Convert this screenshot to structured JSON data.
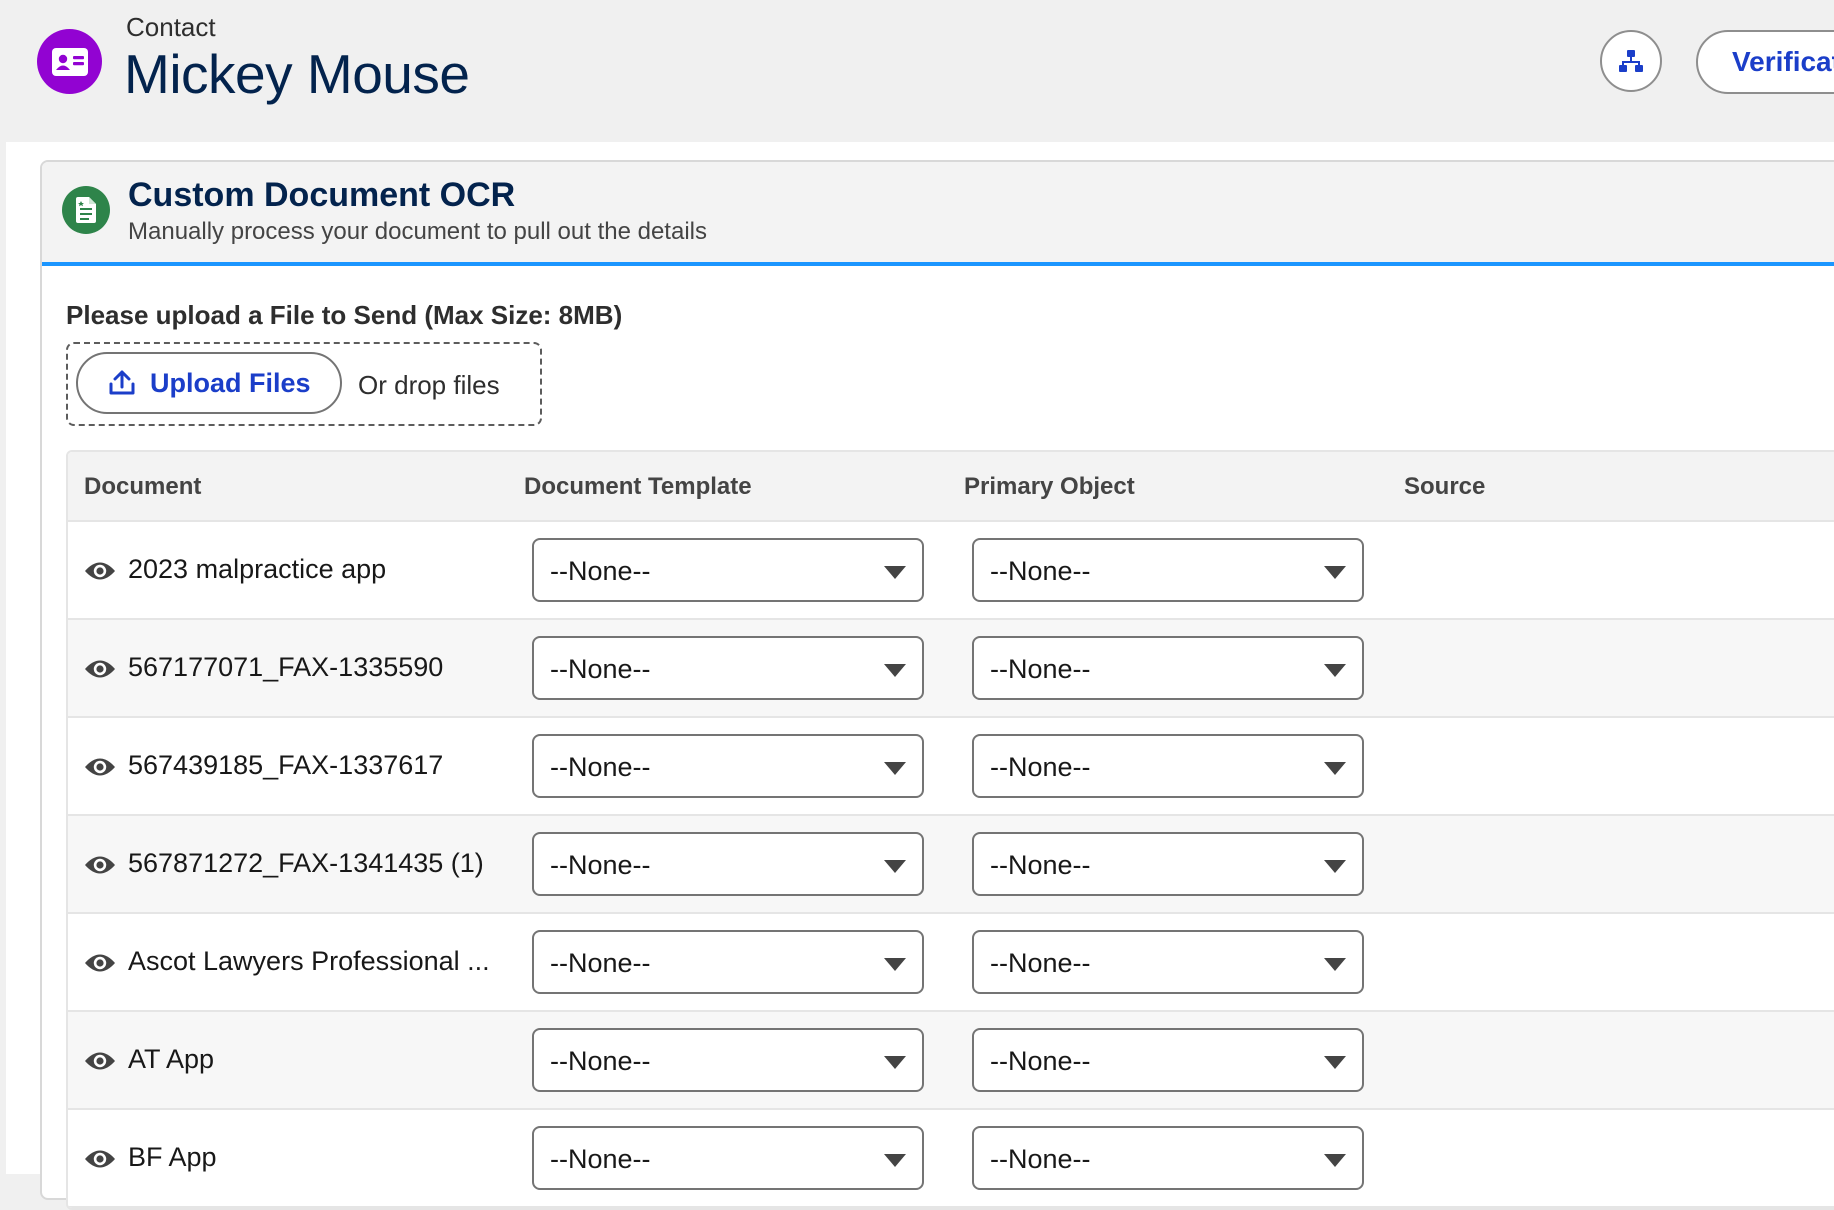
{
  "header": {
    "record_type": "Contact",
    "record_name": "Mickey Mouse",
    "verification_label": "Verificat",
    "icons": {
      "record": "contact-card-icon",
      "hierarchy": "hierarchy-icon"
    }
  },
  "card": {
    "title": "Custom Document OCR",
    "subtitle": "Manually process your document to pull out the details",
    "icon": "document-icon",
    "upload_label": "Please upload a File to Send (Max Size: 8MB)",
    "upload_button": "Upload Files",
    "drop_text": "Or drop files"
  },
  "table": {
    "columns": [
      "Document",
      "Document Template",
      "Primary Object",
      "Source"
    ],
    "rows": [
      {
        "document": "2023 malpractice app",
        "template": "--None--",
        "primary_object": "--None--",
        "source": ""
      },
      {
        "document": "567177071_FAX-1335590",
        "template": "--None--",
        "primary_object": "--None--",
        "source": ""
      },
      {
        "document": "567439185_FAX-1337617",
        "template": "--None--",
        "primary_object": "--None--",
        "source": ""
      },
      {
        "document": "567871272_FAX-1341435 (1)",
        "template": "--None--",
        "primary_object": "--None--",
        "source": ""
      },
      {
        "document": "Ascot Lawyers Professional ...",
        "template": "--None--",
        "primary_object": "--None--",
        "source": ""
      },
      {
        "document": "AT App",
        "template": "--None--",
        "primary_object": "--None--",
        "source": ""
      },
      {
        "document": "BF App",
        "template": "--None--",
        "primary_object": "--None--",
        "source": ""
      }
    ]
  },
  "colors": {
    "record_icon": "#9203d2",
    "card_icon": "#2e844a",
    "brand_blue": "#1b3ec9",
    "accent_border": "#1b96ff",
    "title_navy": "#03234d"
  }
}
